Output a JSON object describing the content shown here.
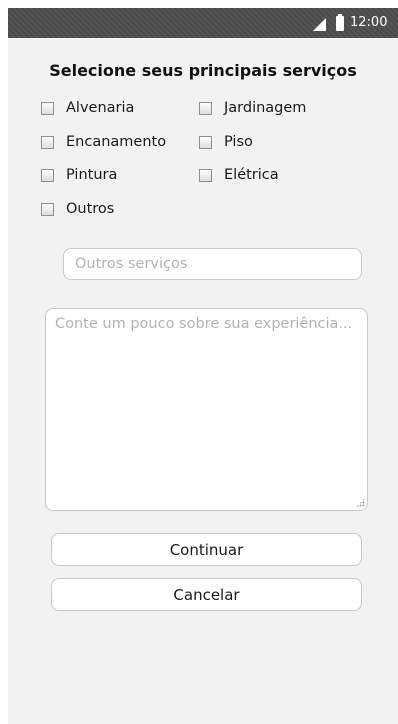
{
  "status_bar": {
    "time": "12:00",
    "icons": [
      "signal-icon",
      "battery-icon"
    ]
  },
  "form": {
    "title": "Selecione seus principais serviços",
    "services": [
      {
        "label": "Alvenaria",
        "checked": false
      },
      {
        "label": "Jardinagem",
        "checked": false
      },
      {
        "label": "Encanamento",
        "checked": false
      },
      {
        "label": "Piso",
        "checked": false
      },
      {
        "label": "Pintura",
        "checked": false
      },
      {
        "label": "Elétrica",
        "checked": false
      },
      {
        "label": "Outros",
        "checked": false
      }
    ],
    "other_services": {
      "value": "",
      "placeholder": "Outros serviços"
    },
    "experience": {
      "value": "",
      "placeholder": "Conte um pouco sobre sua experiência..."
    }
  },
  "actions": {
    "continue_label": "Continuar",
    "cancel_label": "Cancelar"
  },
  "colors": {
    "status_bar": "#4a4a4a",
    "background": "#f2f2f2",
    "border": "#c8c8c8",
    "placeholder": "#b3b3b3"
  }
}
